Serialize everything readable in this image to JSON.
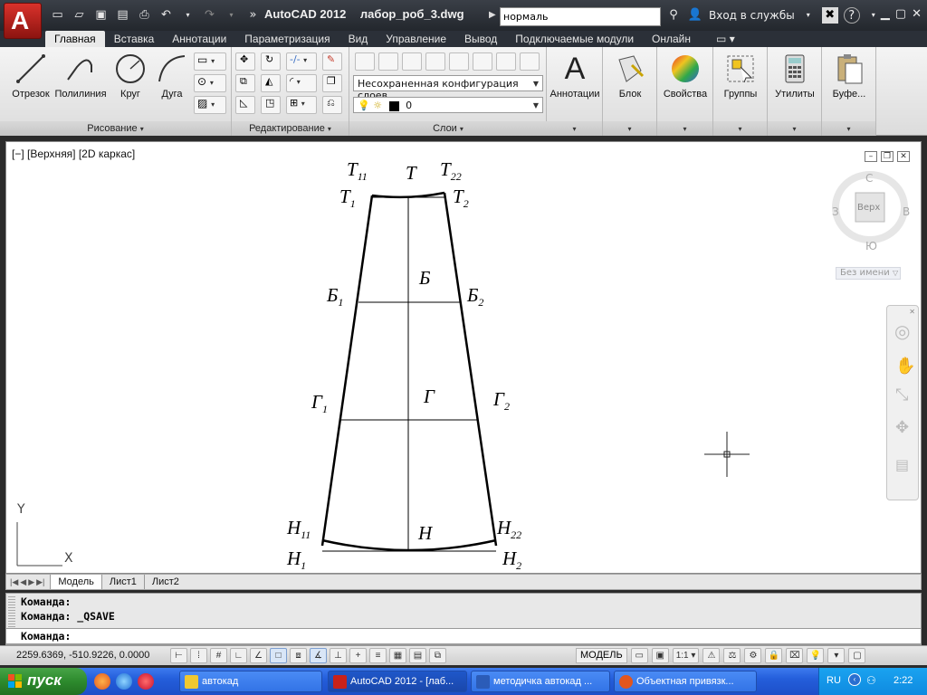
{
  "titlebar": {
    "app_name": "AutoCAD 2012",
    "file_name": "лабор_роб_3.dwg",
    "workspace_value": "нормаль",
    "signin": "Вход в службы"
  },
  "ribbon_tabs": [
    "Главная",
    "Вставка",
    "Аннотации",
    "Параметризация",
    "Вид",
    "Управление",
    "Вывод",
    "Подключаемые модули",
    "Онлайн"
  ],
  "ribbon": {
    "draw": {
      "footer": "Рисование",
      "line": "Отрезок",
      "polyline": "Полилиния",
      "circle": "Круг",
      "arc": "Дуга"
    },
    "modify": {
      "footer": "Редактирование"
    },
    "layers": {
      "footer": "Слои",
      "state": "Несохраненная конфигурация слоев",
      "current_layer": "0"
    },
    "annotation": "Аннотации",
    "block": "Блок",
    "properties": "Свойства",
    "groups": "Группы",
    "utilities": "Утилиты",
    "clipboard": "Буфе..."
  },
  "drawing": {
    "view_label": "[−] [Верхняя] [2D каркас]",
    "viewcube": {
      "north": "С",
      "south": "Ю",
      "west": "З",
      "east": "В",
      "face": "Верх",
      "ucs_name": "Без имени"
    },
    "ucs": {
      "y": "Y",
      "x": "X"
    },
    "labels": {
      "t11": "Т",
      "t11_sub": "11",
      "t": "Т",
      "t22": "Т",
      "t22_sub": "22",
      "t1": "Т",
      "t1_sub": "1",
      "t2": "Т",
      "t2_sub": "2",
      "b1": "Б",
      "b1_sub": "1",
      "b": "Б",
      "b2": "Б",
      "b2_sub": "2",
      "g1": "Г",
      "g1_sub": "1",
      "g": "Г",
      "g2": "Г",
      "g2_sub": "2",
      "n11": "Н",
      "n11_sub": "11",
      "n": "Н",
      "n22": "Н",
      "n22_sub": "22",
      "n1": "Н",
      "n1_sub": "1",
      "n2": "Н",
      "n2_sub": "2"
    }
  },
  "layout_tabs": [
    "Модель",
    "Лист1",
    "Лист2"
  ],
  "command": {
    "line1": "Команда:",
    "line2": "Команда: _QSAVE",
    "prompt": "Команда:"
  },
  "status": {
    "coords": "2259.6369, -510.9226, 0.0000",
    "model": "МОДЕЛЬ",
    "scale": "1:1"
  },
  "taskbar": {
    "start": "пуск",
    "tasks": [
      "автокад",
      "AutoCAD 2012 - [лаб...",
      "методичка автокад ...",
      "Объектная привязк..."
    ],
    "lang": "RU",
    "time": "2:22"
  }
}
